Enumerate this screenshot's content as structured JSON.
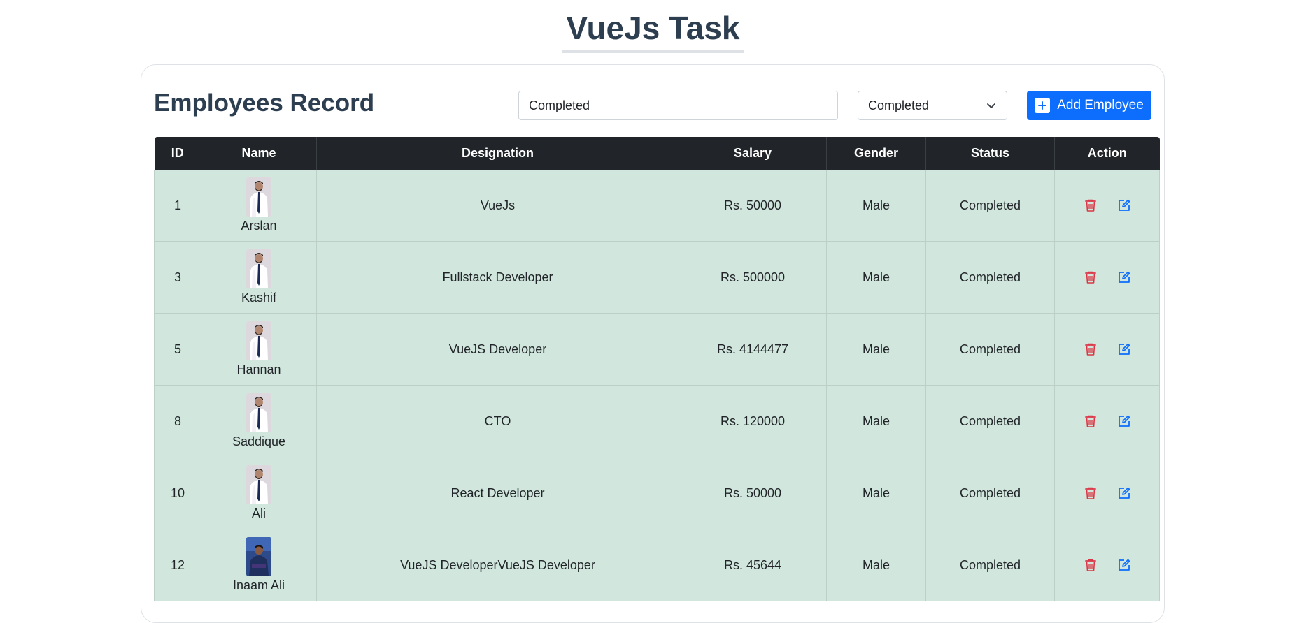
{
  "page": {
    "title": "VueJs Task"
  },
  "card": {
    "title": "Employees Record",
    "search": {
      "value": "Completed",
      "placeholder": ""
    },
    "status_filter": {
      "selected": "Completed"
    },
    "add_button_label": "Add Employee"
  },
  "table": {
    "headers": [
      "ID",
      "Name",
      "Designation",
      "Salary",
      "Gender",
      "Status",
      "Action"
    ],
    "rows": [
      {
        "id": "1",
        "name": "Arslan",
        "designation": "VueJs",
        "salary": "Rs. 50000",
        "gender": "Male",
        "status": "Completed",
        "avatar": "portrait-light"
      },
      {
        "id": "3",
        "name": "Kashif",
        "designation": "Fullstack Developer",
        "salary": "Rs. 500000",
        "gender": "Male",
        "status": "Completed",
        "avatar": "portrait-light"
      },
      {
        "id": "5",
        "name": "Hannan",
        "designation": "VueJS Developer",
        "salary": "Rs. 4144477",
        "gender": "Male",
        "status": "Completed",
        "avatar": "portrait-light"
      },
      {
        "id": "8",
        "name": "Saddique",
        "designation": "CTO",
        "salary": "Rs. 120000",
        "gender": "Male",
        "status": "Completed",
        "avatar": "portrait-light"
      },
      {
        "id": "10",
        "name": "Ali",
        "designation": "React Developer",
        "salary": "Rs. 50000",
        "gender": "Male",
        "status": "Completed",
        "avatar": "portrait-light"
      },
      {
        "id": "12",
        "name": "Inaam Ali",
        "designation": "VueJS DeveloperVueJS Developer",
        "salary": "Rs. 45644",
        "gender": "Male",
        "status": "Completed",
        "avatar": "portrait-dark"
      }
    ]
  },
  "icons": {
    "delete": "trash-icon",
    "edit": "edit-icon",
    "add": "plus-icon",
    "dropdown": "chevron-down-icon"
  },
  "colors": {
    "primary": "#0d6efd",
    "header_bg": "#212529",
    "row_bg": "#d1e7dd",
    "delete": "#dc3545",
    "edit": "#0d6efd",
    "title": "#2c3e50"
  }
}
